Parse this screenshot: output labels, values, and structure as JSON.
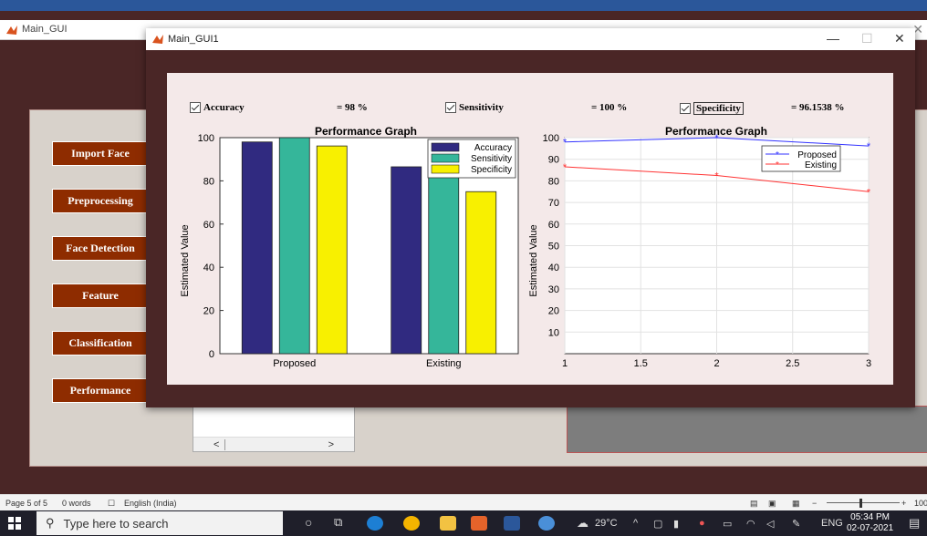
{
  "main_gui": {
    "title": "Main_GUI",
    "close": "✕"
  },
  "buttons": [
    "Import Face",
    "Preprocessing",
    "Face Detection",
    "Feature",
    "Classification",
    "Performance"
  ],
  "listbox": {
    "left_arrow": "<",
    "right_arrow": ">"
  },
  "gui1": {
    "title": "Main_GUI1",
    "minimize": "—",
    "maximize": "☐",
    "close": "✕"
  },
  "metrics": [
    {
      "label": "Accuracy",
      "value": "= 98 %"
    },
    {
      "label": "Sensitivity",
      "value": "= 100 %"
    },
    {
      "label": "Specificity",
      "value": "= 96.1538 %"
    }
  ],
  "colors": {
    "accuracy": "#302a80",
    "sensitivity": "#35b69a",
    "specificity": "#f8f000",
    "proposed": "#3333ff",
    "existing": "#ff3333",
    "button_bg": "#8e2c00"
  },
  "chart_data": [
    {
      "type": "bar",
      "title": "Performance Graph",
      "ylabel": "Estimated Value",
      "xlabel": "",
      "categories": [
        "Proposed",
        "Existing"
      ],
      "series": [
        {
          "name": "Accuracy",
          "values": [
            98,
            86.5
          ]
        },
        {
          "name": "Sensitivity",
          "values": [
            100,
            94
          ]
        },
        {
          "name": "Specificity",
          "values": [
            96.1538,
            75
          ]
        }
      ],
      "ylim": [
        0,
        100
      ],
      "yticks": [
        0,
        20,
        40,
        60,
        80,
        100
      ],
      "grid": false,
      "legend": "top-right"
    },
    {
      "type": "line",
      "title": "Performance Graph",
      "ylabel": "Estimated Value",
      "xlabel": "",
      "x": [
        1,
        2,
        3
      ],
      "series": [
        {
          "name": "Proposed",
          "values": [
            98,
            100,
            96.1538
          ]
        },
        {
          "name": "Existing",
          "values": [
            86.5,
            82.5,
            75
          ]
        }
      ],
      "xlim": [
        1,
        3
      ],
      "ylim": [
        0,
        100
      ],
      "xticks": [
        "1",
        "1.5",
        "2",
        "2.5",
        "3"
      ],
      "yticks": [
        10,
        20,
        30,
        40,
        50,
        60,
        70,
        80,
        90,
        100
      ],
      "grid": true,
      "legend": "top-right"
    }
  ],
  "statusbar": {
    "page": "Page 5 of 5",
    "words": "0 words",
    "language": "English (India)",
    "zoom": "100"
  },
  "taskbar": {
    "search_placeholder": "Type here to search",
    "weather": "29°C",
    "lang": "ENG",
    "time": "05:34 PM",
    "date": "02-07-2021"
  }
}
